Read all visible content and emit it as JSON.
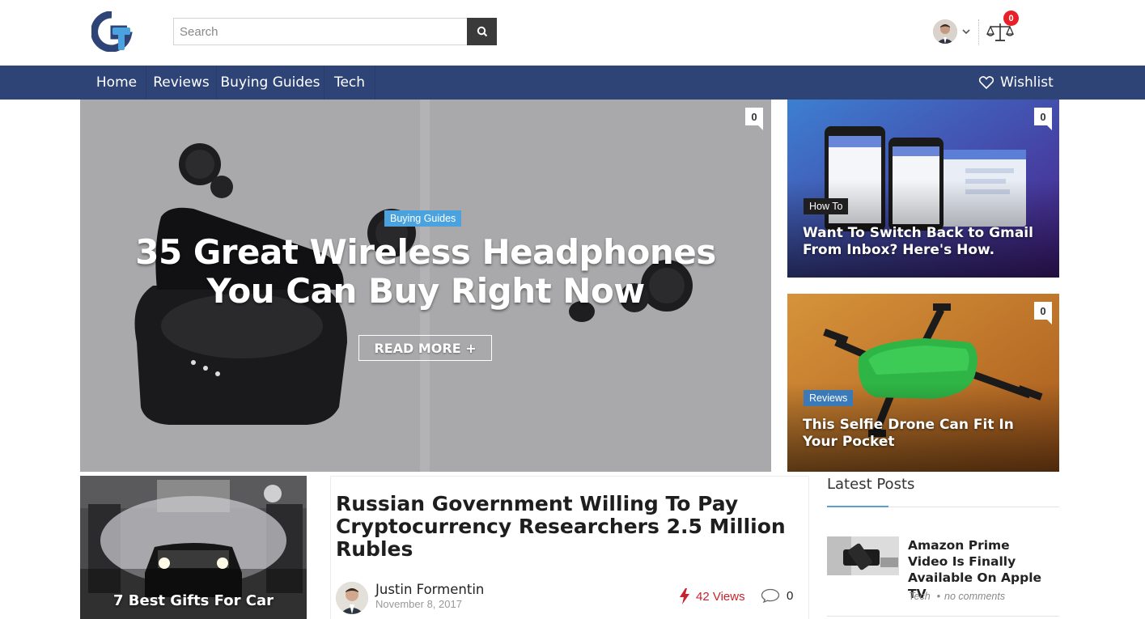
{
  "header": {
    "search": {
      "placeholder": "Search"
    },
    "compare_count": "0"
  },
  "nav": {
    "items": [
      "Home",
      "Reviews",
      "Buying Guides",
      "Tech"
    ],
    "wishlist_label": "Wishlist"
  },
  "hero": {
    "category": "Buying Guides",
    "title": "35 Great Wireless Headphones You Can Buy Right Now",
    "read_more": "READ MORE +",
    "comments": "0"
  },
  "side_posts": [
    {
      "category": "How To",
      "title": "Want To Switch Back to Gmail From Inbox? Here's How.",
      "comments": "0"
    },
    {
      "category": "Reviews",
      "title": "This Selfie Drone Can Fit In Your Pocket",
      "comments": "0"
    }
  ],
  "gift_post": {
    "title": "7 Best Gifts For Car"
  },
  "article": {
    "title": "Russian Government Willing To Pay Cryptocurrency Researchers 2.5 Million Rubles",
    "author": "Justin Formentin",
    "date": "November 8, 2017",
    "views": "42 Views",
    "comments": "0"
  },
  "latest_posts": {
    "heading": "Latest Posts",
    "items": [
      {
        "title": "Amazon Prime Video Is Finally Available On Apple TV",
        "category": "Tech",
        "comments": "no comments"
      }
    ]
  },
  "colors": {
    "nav_bg": "#2f4476",
    "category_blue": "#4aa3df",
    "badge_red": "#e8202a",
    "views_red": "#c8232c"
  },
  "icons": [
    "logo-g-icon",
    "search-icon",
    "chevron-down-icon",
    "scale-compare-icon",
    "heart-icon",
    "comment-icon",
    "flash-icon"
  ]
}
